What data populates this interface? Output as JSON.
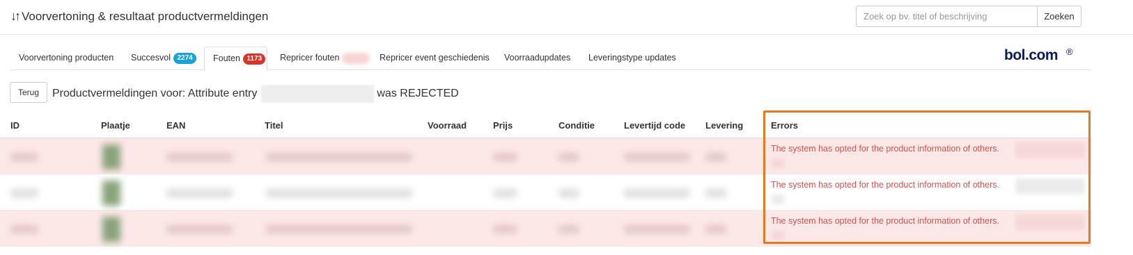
{
  "header": {
    "title": "Voorvertoning & resultaat productvermeldingen",
    "sort_icon": "↓↑",
    "search": {
      "placeholder": "Zoek op bv. titel of beschrijving",
      "value": "",
      "button_label": "Zoeken"
    }
  },
  "tabs": [
    {
      "label": "Voorvertoning producten"
    },
    {
      "label": "Succesvol",
      "badge": "2274"
    },
    {
      "label": "Fouten",
      "badge": "1173",
      "active": true
    },
    {
      "label": "Repricer fouten"
    },
    {
      "label": "Repricer event geschiedenis"
    },
    {
      "label": "Voorraadupdates"
    },
    {
      "label": "Leveringstype updates"
    }
  ],
  "brand": {
    "logo_text": "bol.com",
    "logo_mark": "®"
  },
  "subheader": {
    "back_label": "Terug",
    "title_prefix": "Productvermeldingen voor: Attribute entry",
    "title_suffix": "was REJECTED"
  },
  "table": {
    "columns": [
      "ID",
      "Plaatje",
      "EAN",
      "Titel",
      "Voorraad",
      "Prijs",
      "Conditie",
      "Levertijd code",
      "Levering",
      "Errors"
    ],
    "rows": [
      {
        "error": "The system has opted for the product information of others."
      },
      {
        "error": "The system has opted for the product information of others."
      },
      {
        "error": "The system has opted for the product information of others."
      }
    ]
  },
  "colors": {
    "error_text": "#d9534f",
    "highlight_border": "#e07b24",
    "badge_success": "#17a2d8",
    "badge_error": "#d9342b",
    "row_error_bg": "#fde8e8"
  }
}
